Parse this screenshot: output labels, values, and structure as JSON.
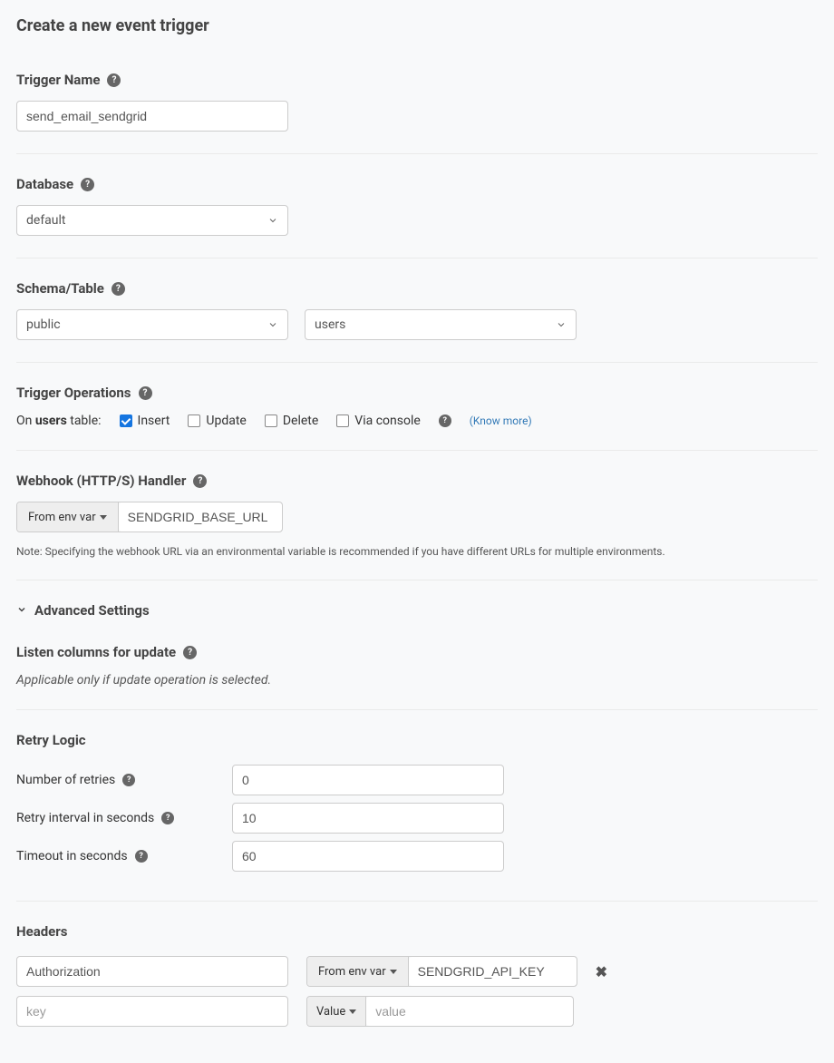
{
  "page_title": "Create a new event trigger",
  "trigger_name": {
    "label": "Trigger Name",
    "value": "send_email_sendgrid"
  },
  "database": {
    "label": "Database",
    "selected": "default"
  },
  "schema_table": {
    "label": "Schema/Table",
    "schema": "public",
    "table": "users"
  },
  "operations": {
    "label": "Trigger Operations",
    "prefix_on": "On ",
    "prefix_table": "users",
    "prefix_suffix": " table:",
    "insert": "Insert",
    "update": "Update",
    "delete": "Delete",
    "via_console": "Via console",
    "know_more": "(Know more)",
    "insert_checked": true,
    "update_checked": false,
    "delete_checked": false,
    "via_console_checked": false
  },
  "webhook": {
    "label": "Webhook (HTTP/S) Handler",
    "source": "From env var",
    "value": "SENDGRID_BASE_URL",
    "note": "Note: Specifying the webhook URL via an environmental variable is recommended if you have different URLs for multiple environments."
  },
  "advanced": {
    "label": "Advanced Settings"
  },
  "listen_columns": {
    "label": "Listen columns for update",
    "note": "Applicable only if update operation is selected."
  },
  "retry": {
    "label": "Retry Logic",
    "num_retries_label": "Number of retries",
    "num_retries": "0",
    "interval_label": "Retry interval in seconds",
    "interval": "10",
    "timeout_label": "Timeout in seconds",
    "timeout": "60"
  },
  "headers": {
    "label": "Headers",
    "rows": [
      {
        "key": "Authorization",
        "source": "From env var",
        "value": "SENDGRID_API_KEY"
      }
    ],
    "empty": {
      "key_placeholder": "key",
      "source": "Value",
      "value_placeholder": "value"
    }
  }
}
